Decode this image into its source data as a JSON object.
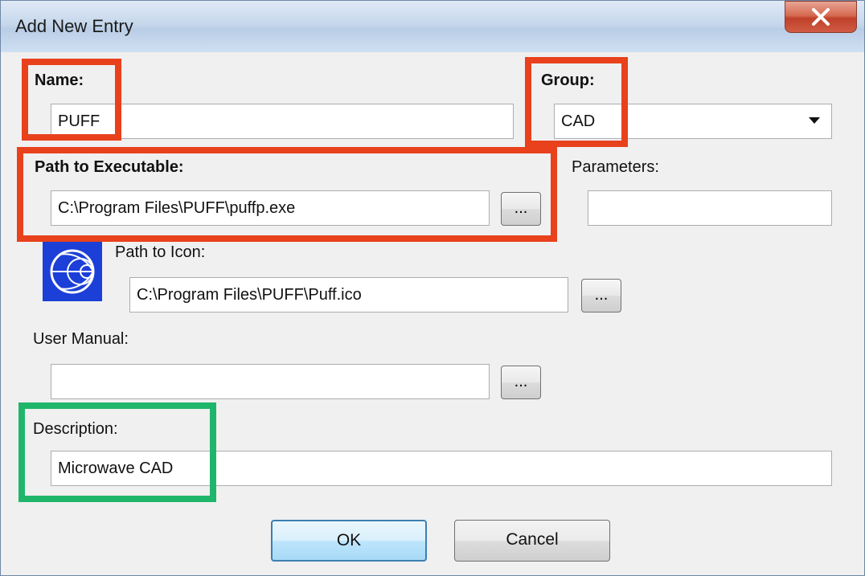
{
  "window": {
    "title": "Add New Entry",
    "close_glyph": "X"
  },
  "form": {
    "name": {
      "label": "Name:",
      "value": "PUFF"
    },
    "group": {
      "label": "Group:",
      "value": "CAD"
    },
    "path_exe": {
      "label": "Path to Executable:",
      "value": "C:\\Program Files\\PUFF\\puffp.exe"
    },
    "parameters": {
      "label": "Parameters:",
      "value": ""
    },
    "path_icon": {
      "label": "Path to Icon:",
      "value": "C:\\Program Files\\PUFF\\Puff.ico"
    },
    "user_manual": {
      "label": "User Manual:",
      "value": ""
    },
    "description": {
      "label": "Description:",
      "value": "Microwave CAD"
    },
    "browse_label": "..."
  },
  "buttons": {
    "ok": "OK",
    "cancel": "Cancel"
  },
  "colors": {
    "highlight_red": "#e8411c",
    "highlight_green": "#1fb66b",
    "icon_blue": "#1c3fd8"
  },
  "icons": {
    "app_icon": "smith-chart-icon"
  }
}
